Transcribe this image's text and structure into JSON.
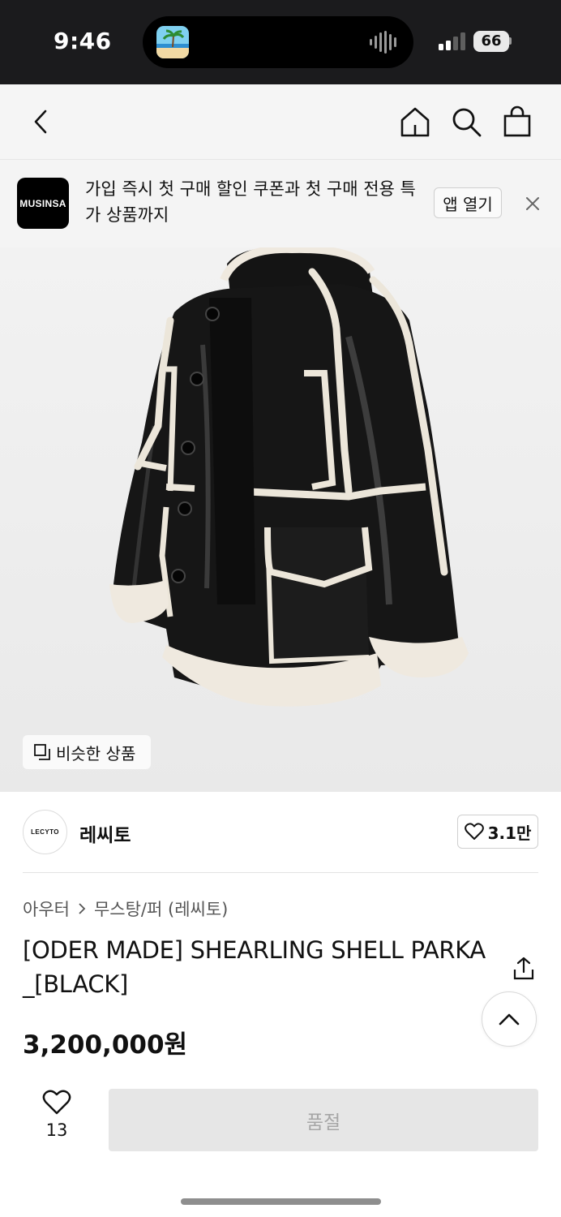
{
  "status_bar": {
    "time": "9:46",
    "battery": "66"
  },
  "nav": {
    "back_icon": "chevron-left-icon",
    "home_icon": "home-icon",
    "search_icon": "search-icon",
    "cart_icon": "shopping-bag-icon"
  },
  "app_banner": {
    "logo_text": "MUSINSA",
    "message": "가입 즉시 첫 구매 할인 쿠폰과 첫 구매 전용 특가 상품까지",
    "open_button": "앱 열기",
    "close_icon": "close-icon"
  },
  "product_image": {
    "similar_button": "비슷한 상품",
    "similar_icon": "similar-items-icon"
  },
  "brand": {
    "logo_text": "LECYTO",
    "name": "레씨토",
    "like_count": "3.1만"
  },
  "breadcrumb": {
    "category": "아우터",
    "subcategory": "무스탕/퍼 (레씨토)"
  },
  "product": {
    "title": "[ODER MADE] SHEARLING SHELL PARKA_[BLACK]",
    "price": "3,200,000원"
  },
  "bottom_bar": {
    "wish_count": "13",
    "soldout_label": "품절"
  },
  "colors": {
    "soldout_bg": "#e6e6e6",
    "soldout_text": "#a6a6a6",
    "status_bar": "#1b1b1d"
  }
}
